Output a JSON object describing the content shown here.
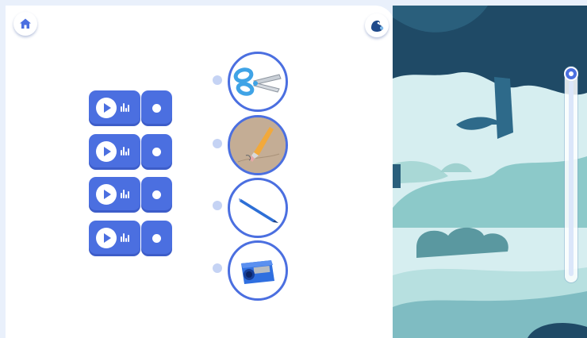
{
  "screen": {
    "home_button": {
      "icon": "home-icon"
    },
    "mascot_button": {
      "icon": "mascot-icon"
    },
    "audio_pairs": [
      {
        "play_icon": "play-icon",
        "wave_icon": "waveform-icon",
        "record_icon": "record-icon"
      },
      {
        "play_icon": "play-icon",
        "wave_icon": "waveform-icon",
        "record_icon": "record-icon"
      },
      {
        "play_icon": "play-icon",
        "wave_icon": "waveform-icon",
        "record_icon": "record-icon"
      },
      {
        "play_icon": "play-icon",
        "wave_icon": "waveform-icon",
        "record_icon": "record-icon"
      }
    ],
    "picture_items": [
      {
        "name": "scissors",
        "icon": "scissors-icon"
      },
      {
        "name": "pencil-eraser",
        "icon": "pencil-icon"
      },
      {
        "name": "pen",
        "icon": "pen-icon"
      },
      {
        "name": "sharpener",
        "icon": "sharpener-icon"
      }
    ],
    "scroll_position": 0,
    "colors": {
      "accent": "#4b6fe0",
      "card": "#ffffff",
      "frame": "#e9f0fb",
      "forest_dark": "#1f4a66",
      "forest_teal": "#7fbcc2",
      "forest_light": "#cdeaec"
    }
  }
}
